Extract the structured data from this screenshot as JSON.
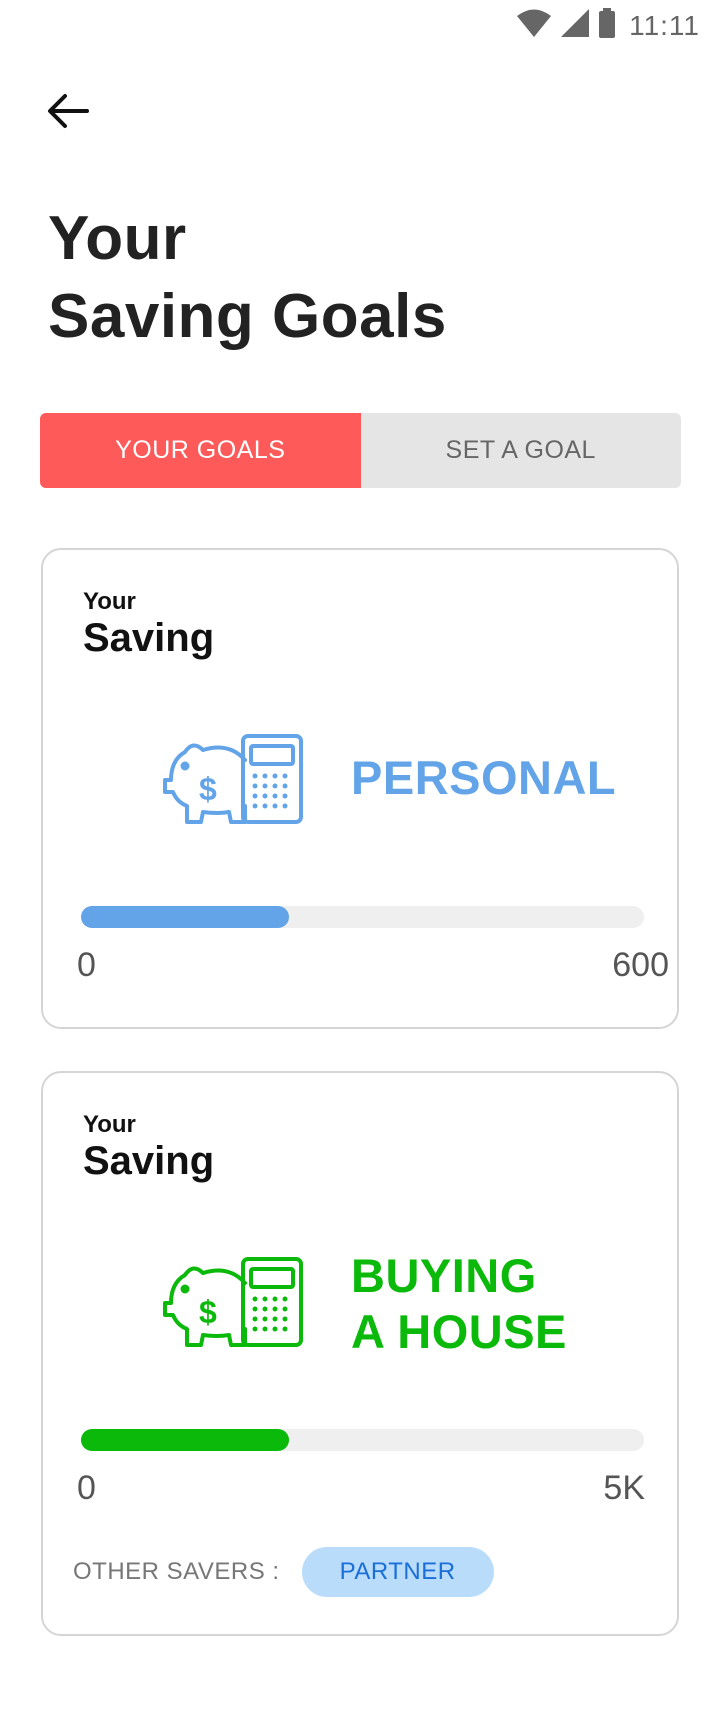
{
  "status_bar": {
    "time": "11:11",
    "icons": [
      "wifi-icon",
      "signal-icon",
      "battery-icon"
    ]
  },
  "header": {
    "back_icon": "back-arrow-icon",
    "title_line1": "Your",
    "title_line2": "Saving Goals"
  },
  "tabs": [
    {
      "label": "YOUR GOALS",
      "active": true
    },
    {
      "label": "SET A GOAL",
      "active": false
    }
  ],
  "goals": [
    {
      "eyebrow": "Your",
      "heading": "Saving",
      "icon": "piggy-bank-calculator-icon",
      "name_line1": "PERSONAL",
      "name_line2": "",
      "color": "#63a4e8",
      "progress": 0.37,
      "min_label": "0",
      "max_label": "600"
    },
    {
      "eyebrow": "Your",
      "heading": "Saving",
      "icon": "piggy-bank-calculator-icon",
      "name_line1": "BUYING",
      "name_line2": "A HOUSE",
      "color": "#0bb90b",
      "progress": 0.37,
      "min_label": "0",
      "max_label": "5K",
      "other_savers_label": "OTHER SAVERS :",
      "other_savers": [
        "PARTNER"
      ]
    }
  ],
  "colors": {
    "accent_tab": "#ff5a5a",
    "personal": "#63a4e8",
    "house": "#0bb90b",
    "chip_bg": "#b9dcfb",
    "chip_text": "#1a6ed8"
  }
}
